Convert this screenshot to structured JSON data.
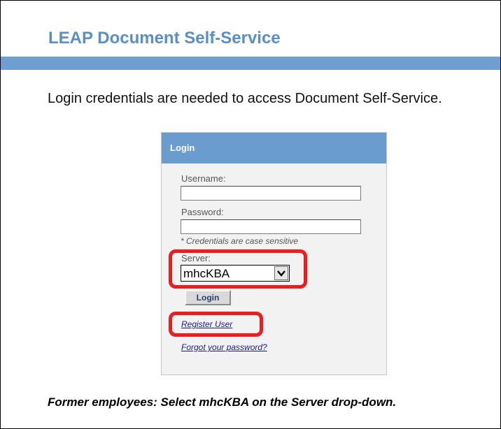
{
  "header": {
    "title": "LEAP Document Self-Service"
  },
  "intro": {
    "text": "Login credentials are needed to access Document Self-Service."
  },
  "login_panel": {
    "title": "Login",
    "username_label": "Username:",
    "username_value": "",
    "password_label": "Password:",
    "password_value": "",
    "hint": "* Credentials are case sensitive",
    "server_label": "Server:",
    "server_selected": "mhcKBA",
    "login_button": "Login",
    "register_link": "Register User",
    "forgot_link": "Forgot your password?"
  },
  "footer": {
    "note": "Former employees: Select mhcKBA on the Server drop-down."
  },
  "colors": {
    "title_blue": "#5b8fc4",
    "band_blue": "#6f9fd1",
    "panel_header_blue": "#6b9ccf",
    "highlight_red": "#ee1c1c",
    "link_color": "#1a1a8c"
  },
  "icons": {
    "dropdown_arrow": "chevron-down-icon"
  }
}
